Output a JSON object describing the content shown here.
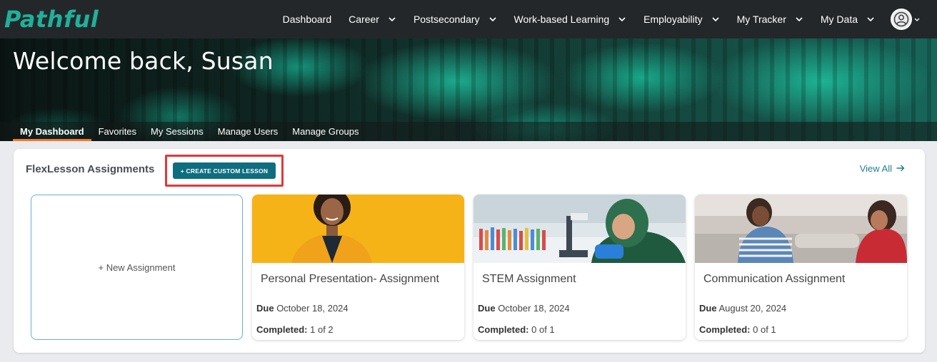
{
  "brand": {
    "logo_text": "Pathful"
  },
  "nav": {
    "items": [
      {
        "label": "Dashboard",
        "dropdown": false
      },
      {
        "label": "Career",
        "dropdown": true
      },
      {
        "label": "Postsecondary",
        "dropdown": true
      },
      {
        "label": "Work-based Learning",
        "dropdown": true
      },
      {
        "label": "Employability",
        "dropdown": true
      },
      {
        "label": "My Tracker",
        "dropdown": true
      },
      {
        "label": "My Data",
        "dropdown": true
      }
    ],
    "avatar_icon": "user-circle-icon"
  },
  "hero": {
    "title": "Welcome back, Susan",
    "tabs": [
      "My Dashboard",
      "Favorites",
      "My Sessions",
      "Manage Users",
      "Manage Groups"
    ],
    "active_tab": "My Dashboard"
  },
  "assignments": {
    "title": "FlexLesson Assignments",
    "create_button": "+ CREATE CUSTOM LESSON",
    "view_all": "View All",
    "new_assignment": "+ New Assignment",
    "cards": [
      {
        "title": "Personal Presentation- Assignment",
        "due_label": "Due",
        "due_date": "October 18, 2024",
        "completed_label": "Completed:",
        "completed": "1 of 2"
      },
      {
        "title": "STEM Assignment",
        "due_label": "Due",
        "due_date": "October 18, 2024",
        "completed_label": "Completed:",
        "completed": "0 of 1"
      },
      {
        "title": "Communication Assignment",
        "due_label": "Due",
        "due_date": "August 20, 2024",
        "completed_label": "Completed:",
        "completed": "0 of 1"
      }
    ]
  },
  "colors": {
    "nav_bg": "#24272a",
    "brand_teal": "#1fb09b",
    "button_teal": "#0f6d80",
    "link_blue": "#1f7e95",
    "active_tab_underline": "#f07a2c",
    "highlight_red": "#e0393b"
  }
}
